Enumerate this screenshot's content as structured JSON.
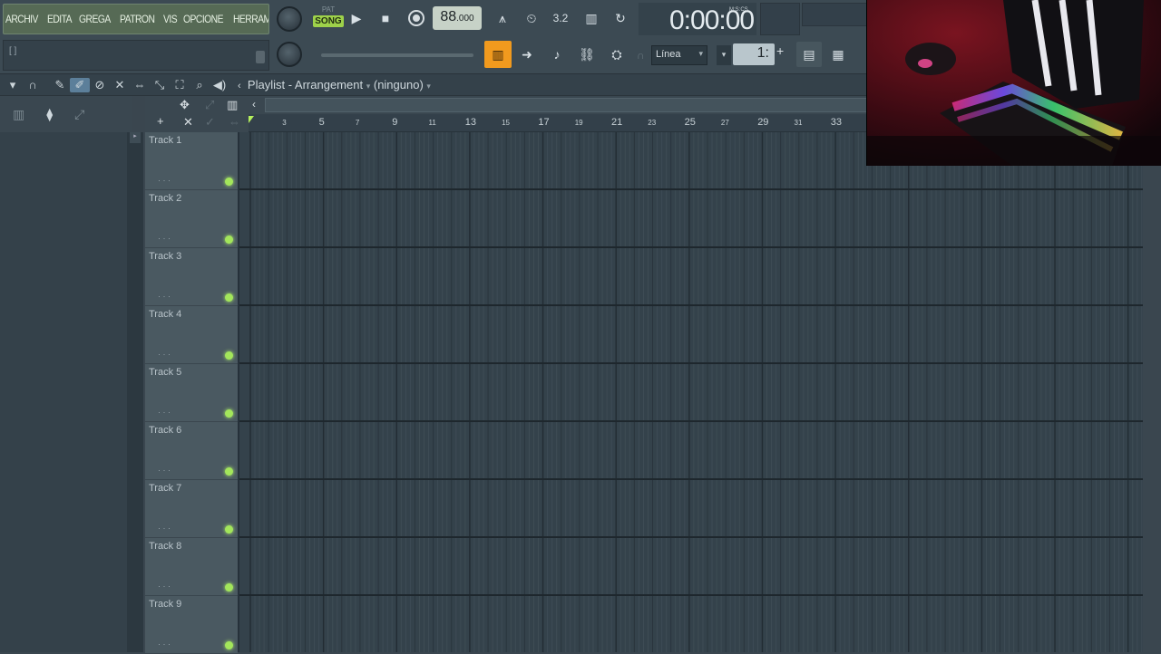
{
  "menu": {
    "items": [
      "ARCHIV",
      "EDITA",
      "GREGA",
      "PATRON",
      "VIS",
      "OPCIONE",
      "HERRAMIENTA"
    ]
  },
  "hint": {
    "text": "[ ]"
  },
  "transport": {
    "pat_label": "PAT",
    "song_label": "SONG",
    "tempo_int": "88",
    "tempo_frac": ".000"
  },
  "time": {
    "value": "0:00:00",
    "label": "M:S:CS"
  },
  "snap": {
    "selected": "Línea",
    "step_value": "1:"
  },
  "playlist": {
    "title": "Playlist - Arrangement",
    "pattern": "(ninguno)"
  },
  "ruler": {
    "bars": [
      "3",
      "5",
      "7",
      "9",
      "11",
      "13",
      "15",
      "17",
      "19",
      "21",
      "23",
      "25",
      "27",
      "29",
      "31",
      "33"
    ]
  },
  "tracks": [
    "Track 1",
    "Track 2",
    "Track 3",
    "Track 4",
    "Track 5",
    "Track 6",
    "Track 7",
    "Track 8",
    "Track 9"
  ],
  "colors": {
    "accent": "#f19a1e",
    "song_green": "#9ed24a",
    "led_green": "#a3e65b",
    "bg": "#3a464f"
  },
  "icons": {
    "toolbar": [
      "play-icon",
      "stop-icon",
      "record-icon",
      "metronome-icon",
      "typing-keyboard-icon",
      "countdown-icon",
      "step-edit-icon",
      "loop-record-icon"
    ],
    "snap_row": [
      "snap-icon",
      "arrow-right-icon",
      "paint-icon",
      "link-icon",
      "stamp-icon",
      "magnet-icon"
    ],
    "playlist_tools": [
      "chevron-down-icon",
      "magnet-icon",
      "pencil-icon",
      "paint-brush-icon",
      "delete-icon",
      "mute-icon",
      "slip-icon",
      "select-icon",
      "zoom-icon",
      "playback-icon"
    ]
  }
}
